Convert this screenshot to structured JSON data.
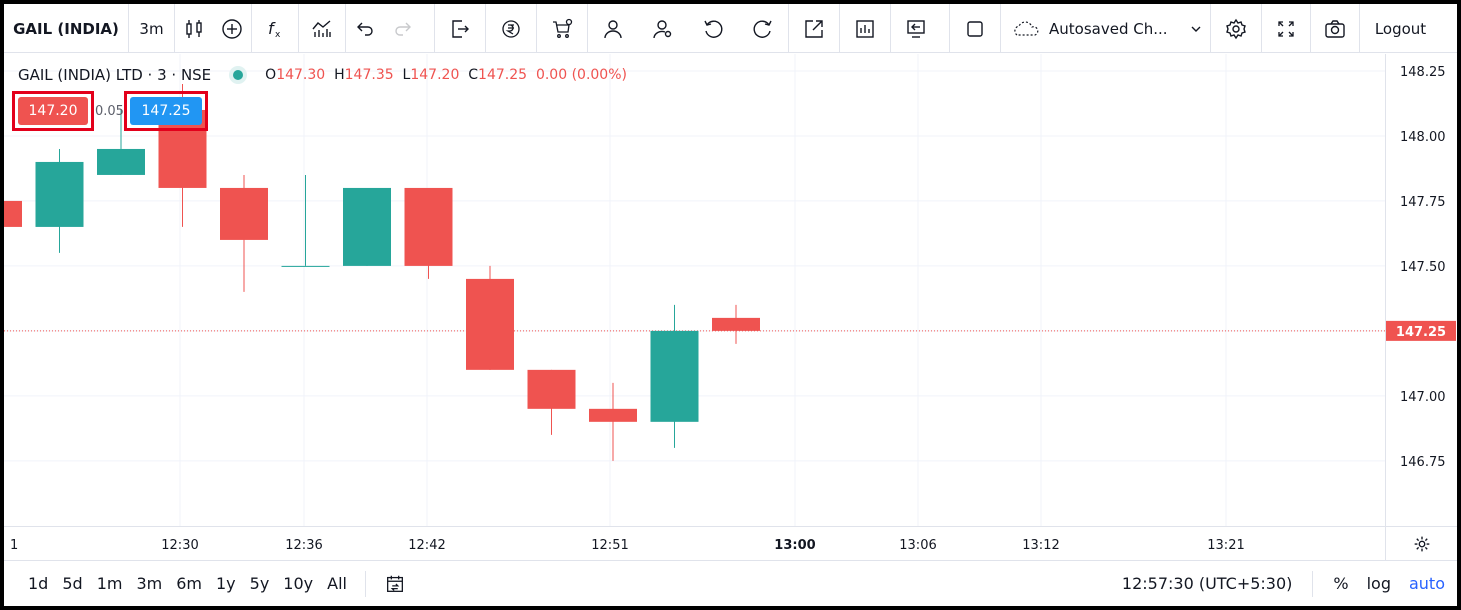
{
  "toolbar": {
    "symbol": "GAIL (INDIA)",
    "interval": "3m",
    "layout_name": "Autosaved Ch...",
    "logout": "Logout",
    "icons": [
      "candles-icon",
      "plus-circle-icon",
      "fx-icon",
      "chart-templates-icon",
      "undo-icon",
      "redo-icon",
      "export-icon",
      "rupee-icon",
      "cart-icon",
      "user-icon",
      "user-settings-icon",
      "reset-icon",
      "refresh-icon",
      "popout-icon",
      "data-window-icon",
      "screen-icon",
      "square-icon",
      "cloud-icon",
      "chevron-down-icon",
      "gear-icon",
      "fullscreen-icon",
      "camera-icon"
    ]
  },
  "legend": {
    "title": "GAIL (INDIA) LTD · 3 · NSE",
    "o_label": "O",
    "o_value": "147.30",
    "h_label": "H",
    "h_value": "147.35",
    "l_label": "L",
    "l_value": "147.20",
    "c_label": "C",
    "c_value": "147.25",
    "change": "0.00 (0.00%)"
  },
  "trade": {
    "sell": "147.20",
    "spread": "0.05",
    "buy": "147.25"
  },
  "price_scale": {
    "ticks": [
      "148.25",
      "148.00",
      "147.75",
      "147.50",
      "147.25",
      "147.00",
      "146.75"
    ],
    "last_price": "147.25"
  },
  "time_scale": {
    "left_edge": "1",
    "ticks": [
      "12:30",
      "12:36",
      "12:42",
      "12:51",
      "13:00",
      "13:06",
      "13:12",
      "13:21"
    ]
  },
  "bottom_bar": {
    "ranges": [
      "1d",
      "5d",
      "1m",
      "3m",
      "6m",
      "1y",
      "5y",
      "10y",
      "All"
    ],
    "clock": "12:57:30 (UTC+5:30)",
    "percent": "%",
    "log": "log",
    "auto": "auto"
  },
  "colors": {
    "up": "#26a69a",
    "down": "#ef5350",
    "accent": "#2962ff",
    "buy": "#2196f3"
  },
  "chart_data": {
    "type": "candlestick",
    "y_range": [
      146.63,
      148.3
    ],
    "candles": [
      {
        "o": 147.75,
        "h": 147.75,
        "l": 147.65,
        "c": 147.65
      },
      {
        "o": 147.65,
        "h": 147.95,
        "l": 147.55,
        "c": 147.9
      },
      {
        "o": 147.85,
        "h": 148.1,
        "l": 147.85,
        "c": 147.95
      },
      {
        "o": 148.1,
        "h": 148.2,
        "l": 147.65,
        "c": 147.8
      },
      {
        "o": 147.8,
        "h": 147.85,
        "l": 147.4,
        "c": 147.6
      },
      {
        "o": 147.5,
        "h": 147.85,
        "l": 147.5,
        "c": 147.5
      },
      {
        "o": 147.5,
        "h": 147.8,
        "l": 147.5,
        "c": 147.8
      },
      {
        "o": 147.8,
        "h": 147.8,
        "l": 147.45,
        "c": 147.5
      },
      {
        "o": 147.45,
        "h": 147.5,
        "l": 147.1,
        "c": 147.1
      },
      {
        "o": 147.1,
        "h": 147.1,
        "l": 146.85,
        "c": 146.95
      },
      {
        "o": 146.95,
        "h": 147.05,
        "l": 146.75,
        "c": 146.9
      },
      {
        "o": 146.9,
        "h": 147.35,
        "l": 146.8,
        "c": 147.25
      },
      {
        "o": 147.3,
        "h": 147.35,
        "l": 147.2,
        "c": 147.25
      }
    ]
  }
}
